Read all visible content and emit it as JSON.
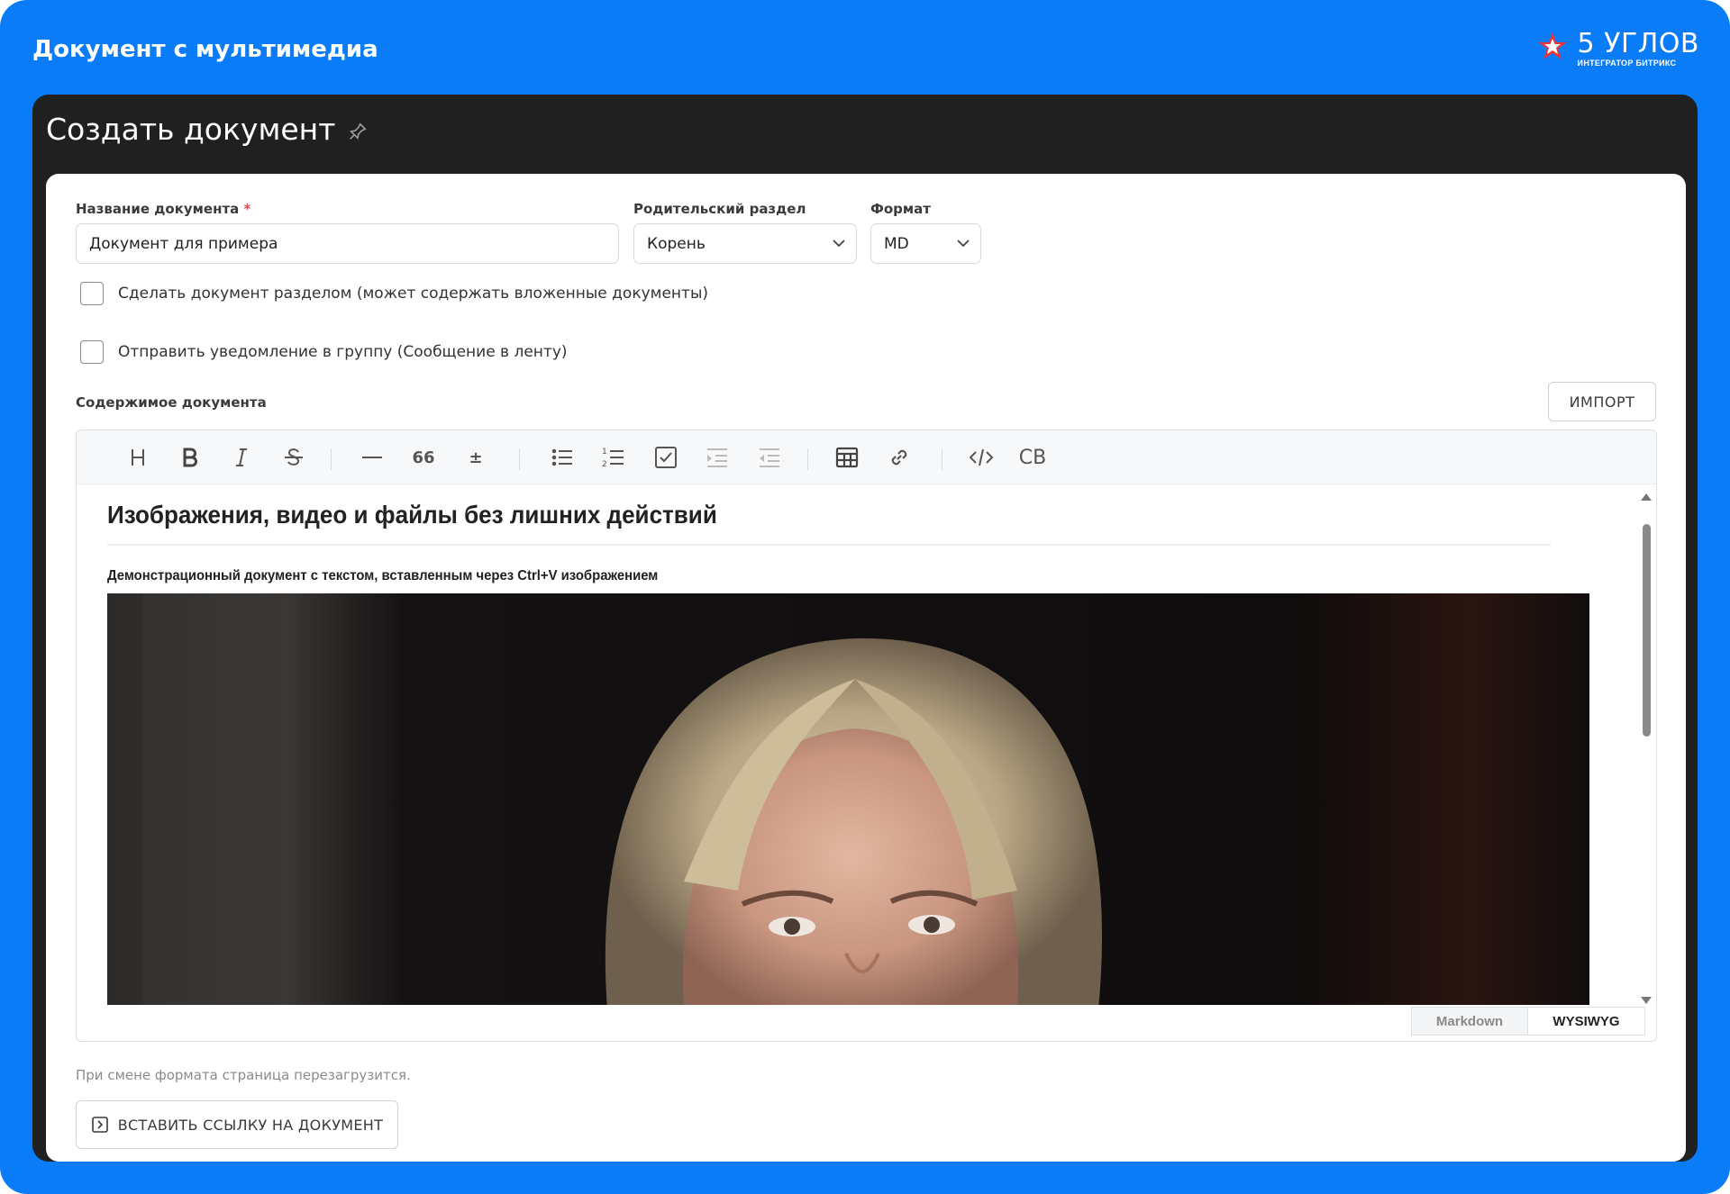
{
  "banner": {
    "title": "Документ с мультимедиа",
    "brand_name": "5 УГЛОВ",
    "brand_sub": "ИНТЕГРАТОР БИТРИКС"
  },
  "header": {
    "title": "Создать документ",
    "pin_icon": "pin-icon"
  },
  "form": {
    "name_label": "Название документа",
    "name_required_mark": "*",
    "name_value": "Документ для примера",
    "parent_label": "Родительский раздел",
    "parent_value": "Корень",
    "format_label": "Формат",
    "format_value": "MD",
    "checkbox_section_label": "Сделать документ разделом (может содержать вложенные документы)",
    "checkbox_section_checked": false,
    "checkbox_notify_label": "Отправить уведомление в группу (Сообщение в ленту)",
    "checkbox_notify_checked": false,
    "content_label": "Содержимое документа",
    "import_label": "ИМПОРТ"
  },
  "toolbar": {
    "items": [
      "heading-icon",
      "bold-icon",
      "italic-icon",
      "strikethrough-icon",
      "horizontal-rule-icon",
      "quote-icon",
      "plus-minus-icon",
      "bullet-list-icon",
      "numbered-list-icon",
      "task-list-icon",
      "indent-icon",
      "outdent-icon",
      "table-icon",
      "link-icon",
      "code-icon",
      "cb-icon"
    ],
    "quote_text": "66",
    "plusminus_text": "±",
    "cb_text": "CB"
  },
  "editor": {
    "heading": "Изображения, видео и файлы без лишних действий",
    "subheading": "Демонстрационный документ с текстом, вставленным через Ctrl+V изображением",
    "mode_markdown": "Markdown",
    "mode_wysiwyg": "WYSIWYG",
    "active_mode": "WYSIWYG"
  },
  "footer": {
    "hint": "При смене формата страница перезагрузится.",
    "insert_link_label": "ВСТАВИТЬ ССЫЛКУ НА ДОКУМЕНТ"
  },
  "colors": {
    "accent_blue": "#0a7cf7",
    "dark_panel": "#202020",
    "required": "#e04b4b"
  }
}
